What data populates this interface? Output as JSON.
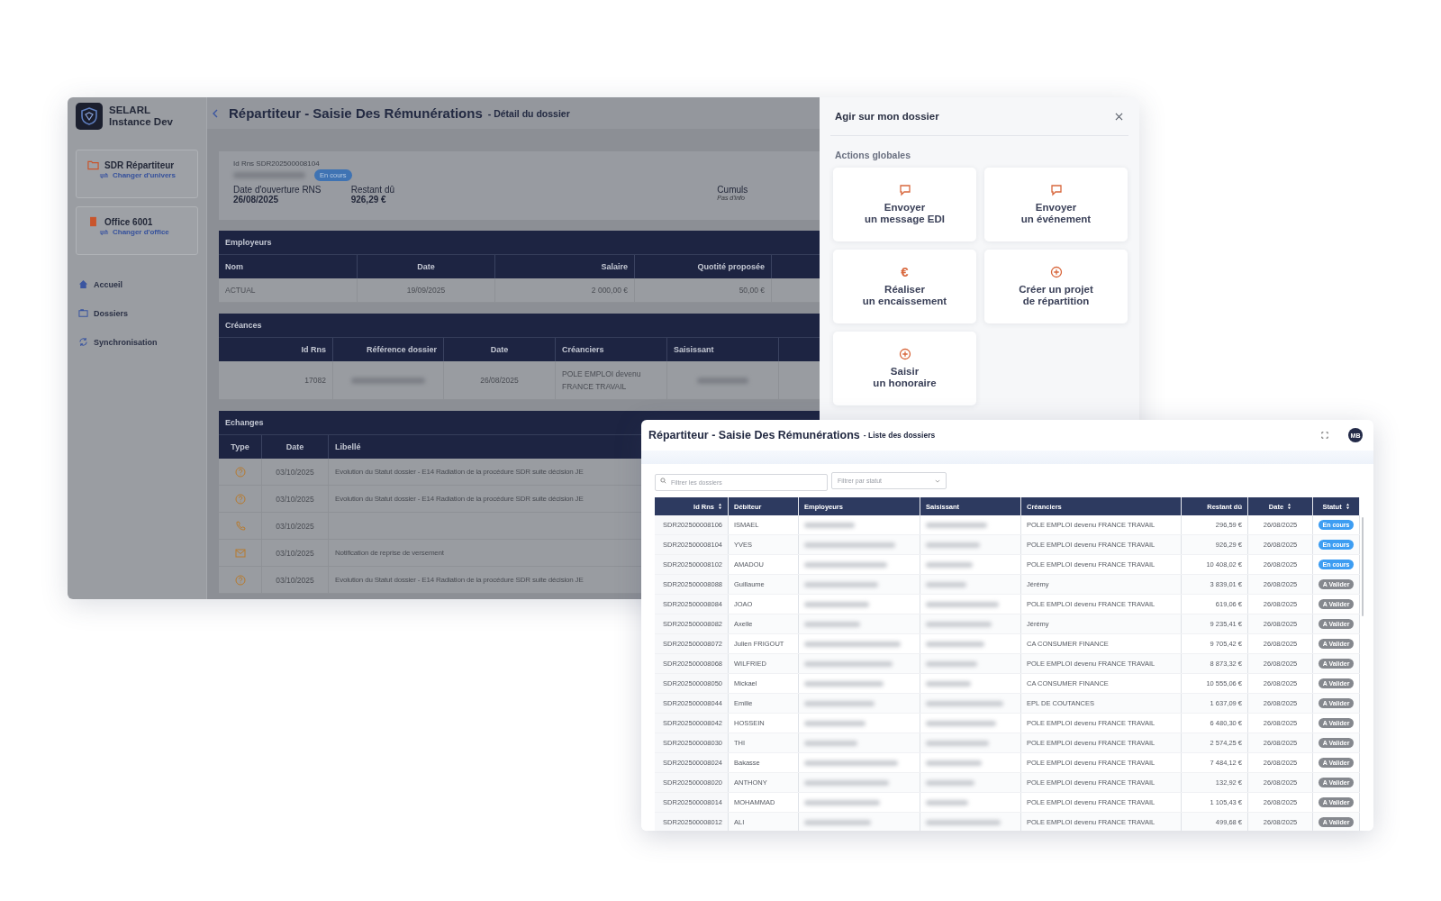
{
  "detail_window": {
    "brand": {
      "name": "SELARL",
      "instance": "Instance Dev"
    },
    "sidebar": {
      "cards": [
        {
          "kind": "folder",
          "title": "SDR Répartiteur",
          "link": "Changer d'univers"
        },
        {
          "kind": "building",
          "title": "Office 6001",
          "link": "Changer d'office"
        }
      ],
      "items": [
        {
          "kind": "home",
          "label": "Accueil"
        },
        {
          "kind": "folder",
          "label": "Dossiers"
        },
        {
          "kind": "sync",
          "label": "Synchronisation"
        }
      ]
    },
    "title": "Répartiteur - Saisie Des Rémunérations",
    "subtitle": "- Détail du dossier",
    "summary": {
      "id_label": "Id Rns",
      "id": "SDR202500008104",
      "status": "En cours",
      "fields": [
        {
          "label": "Date d'ouverture RNS",
          "value": "26/08/2025"
        },
        {
          "label": "Restant dû",
          "value": "926,29 €"
        }
      ],
      "cumuls": {
        "label": "Cumuls",
        "note": "Pas d'info"
      }
    },
    "employeurs": {
      "title": "Employeurs",
      "columns": [
        "Nom",
        "Date",
        "Salaire",
        "Quotité proposée"
      ],
      "rows": [
        [
          "ACTUAL",
          "19/09/2025",
          "2 000,00 €",
          "50,00 €"
        ]
      ]
    },
    "creances": {
      "title": "Créances",
      "columns": [
        "Id Rns",
        "Référence dossier",
        "Date",
        "Créanciers",
        "Saisissant"
      ],
      "rows": [
        [
          "17082",
          null,
          "26/08/2025",
          "POLE EMPLOI devenu FRANCE TRAVAIL",
          null
        ]
      ]
    },
    "echanges": {
      "title": "Echanges",
      "columns": [
        "Type",
        "Date",
        "Libellé"
      ],
      "rows": [
        {
          "kind": "question",
          "date": "03/10/2025",
          "label": "Evolution du Statut dossier - E14 Radiation de la procédure SDR suite décision JE"
        },
        {
          "kind": "question",
          "date": "03/10/2025",
          "label": "Evolution du Statut dossier - E14 Radiation de la procédure SDR suite décision JE"
        },
        {
          "kind": "phone",
          "date": "03/10/2025"
        },
        {
          "kind": "mail",
          "date": "03/10/2025",
          "label": "Notification de reprise de versement"
        },
        {
          "kind": "question",
          "date": "03/10/2025",
          "label": "Evolution du Statut dossier - E14 Radiation de la procédure SDR suite décision JE"
        }
      ]
    },
    "panel": {
      "title": "Agir sur mon dossier",
      "section": "Actions globales",
      "actions": [
        {
          "kind": "chat",
          "lines": [
            "Envoyer",
            "un message EDI"
          ]
        },
        {
          "kind": "chat",
          "lines": [
            "Envoyer",
            "un événement"
          ]
        },
        {
          "kind": "euro",
          "glyph": "€",
          "lines": [
            "Réaliser",
            "un encaissement"
          ]
        },
        {
          "kind": "plus",
          "lines": [
            "Créer un projet",
            "de répartition"
          ]
        },
        {
          "kind": "plus",
          "lines": [
            "Saisir",
            "un honoraire"
          ]
        }
      ]
    }
  },
  "list_window": {
    "title": "Répartiteur - Saisie Des Rémunérations",
    "subtitle": "- Liste des dossiers",
    "avatar": "MB",
    "search": {
      "placeholder": "Filtrer les dossiers"
    },
    "status_filter": {
      "placeholder": "Filtrer par statut"
    },
    "table": {
      "columns": [
        {
          "label": "Id Rns",
          "sortable": true
        },
        {
          "label": "Débiteur",
          "sortable": false
        },
        {
          "label": "Employeurs",
          "sortable": false
        },
        {
          "label": "Saisissant",
          "sortable": false
        },
        {
          "label": "Créanciers",
          "sortable": false
        },
        {
          "label": "Restant dû",
          "sortable": false
        },
        {
          "label": "Date",
          "sortable": true
        },
        {
          "label": "Statut",
          "sortable": true
        }
      ],
      "rows": [
        {
          "cells": [
            "SDR202500008106",
            "ISMAEL",
            null,
            null,
            "POLE EMPLOI devenu FRANCE TRAVAIL",
            "296,59 €",
            "26/08/2025"
          ],
          "status": {
            "label": "En cours",
            "color": "#3d9df2"
          }
        },
        {
          "cells": [
            "SDR202500008104",
            "YVES",
            null,
            null,
            "POLE EMPLOI devenu FRANCE TRAVAIL",
            "926,29 €",
            "26/08/2025"
          ],
          "status": {
            "label": "En cours",
            "color": "#3d9df2"
          }
        },
        {
          "cells": [
            "SDR202500008102",
            "AMADOU",
            null,
            null,
            "POLE EMPLOI devenu FRANCE TRAVAIL",
            "10 408,02 €",
            "26/08/2025"
          ],
          "status": {
            "label": "En cours",
            "color": "#3d9df2"
          }
        },
        {
          "cells": [
            "SDR202500008088",
            "Guillaume",
            null,
            null,
            "Jérémy",
            "3 839,01 €",
            "26/08/2025"
          ],
          "status": {
            "label": "A Valider",
            "color": "#85888e"
          }
        },
        {
          "cells": [
            "SDR202500008084",
            "JOAO",
            null,
            null,
            "POLE EMPLOI devenu FRANCE TRAVAIL",
            "619,06 €",
            "26/08/2025"
          ],
          "status": {
            "label": "A Valider",
            "color": "#85888e"
          }
        },
        {
          "cells": [
            "SDR202500008082",
            "Axelle",
            null,
            null,
            "Jérémy",
            "9 235,41 €",
            "26/08/2025"
          ],
          "status": {
            "label": "A Valider",
            "color": "#85888e"
          }
        },
        {
          "cells": [
            "SDR202500008072",
            "Julien FRIGOUT",
            null,
            null,
            "CA CONSUMER FINANCE",
            "9 705,42 €",
            "26/08/2025"
          ],
          "status": {
            "label": "A Valider",
            "color": "#85888e"
          }
        },
        {
          "cells": [
            "SDR202500008068",
            "WILFRIED",
            null,
            null,
            "POLE EMPLOI devenu FRANCE TRAVAIL",
            "8 873,32 €",
            "26/08/2025"
          ],
          "status": {
            "label": "A Valider",
            "color": "#85888e"
          }
        },
        {
          "cells": [
            "SDR202500008050",
            "Mickael",
            null,
            null,
            "CA CONSUMER FINANCE",
            "10 555,06 €",
            "26/08/2025"
          ],
          "status": {
            "label": "A Valider",
            "color": "#85888e"
          }
        },
        {
          "cells": [
            "SDR202500008044",
            "Emilie",
            null,
            null,
            "EPL DE COUTANCES",
            "1 637,09 €",
            "26/08/2025"
          ],
          "status": {
            "label": "A Valider",
            "color": "#85888e"
          }
        },
        {
          "cells": [
            "SDR202500008042",
            "HOSSEIN",
            null,
            null,
            "POLE EMPLOI devenu FRANCE TRAVAIL",
            "6 480,30 €",
            "26/08/2025"
          ],
          "status": {
            "label": "A Valider",
            "color": "#85888e"
          }
        },
        {
          "cells": [
            "SDR202500008030",
            "THI",
            null,
            null,
            "POLE EMPLOI devenu FRANCE TRAVAIL",
            "2 574,25 €",
            "26/08/2025"
          ],
          "status": {
            "label": "A Valider",
            "color": "#85888e"
          }
        },
        {
          "cells": [
            "SDR202500008024",
            "Bakasse",
            null,
            null,
            "POLE EMPLOI devenu FRANCE TRAVAIL",
            "7 484,12 €",
            "26/08/2025"
          ],
          "status": {
            "label": "A Valider",
            "color": "#85888e"
          }
        },
        {
          "cells": [
            "SDR202500008020",
            "ANTHONY",
            null,
            null,
            "POLE EMPLOI devenu FRANCE TRAVAIL",
            "132,92 €",
            "26/08/2025"
          ],
          "status": {
            "label": "A Valider",
            "color": "#85888e"
          }
        },
        {
          "cells": [
            "SDR202500008014",
            "MOHAMMAD",
            null,
            null,
            "POLE EMPLOI devenu FRANCE TRAVAIL",
            "1 105,43 €",
            "26/08/2025"
          ],
          "status": {
            "label": "A Valider",
            "color": "#85888e"
          }
        },
        {
          "cells": [
            "SDR202500008012",
            "ALI",
            null,
            null,
            "POLE EMPLOI devenu FRANCE TRAVAIL",
            "499,68 €",
            "26/08/2025"
          ],
          "status": {
            "label": "A Valider",
            "color": "#85888e"
          }
        }
      ]
    }
  }
}
